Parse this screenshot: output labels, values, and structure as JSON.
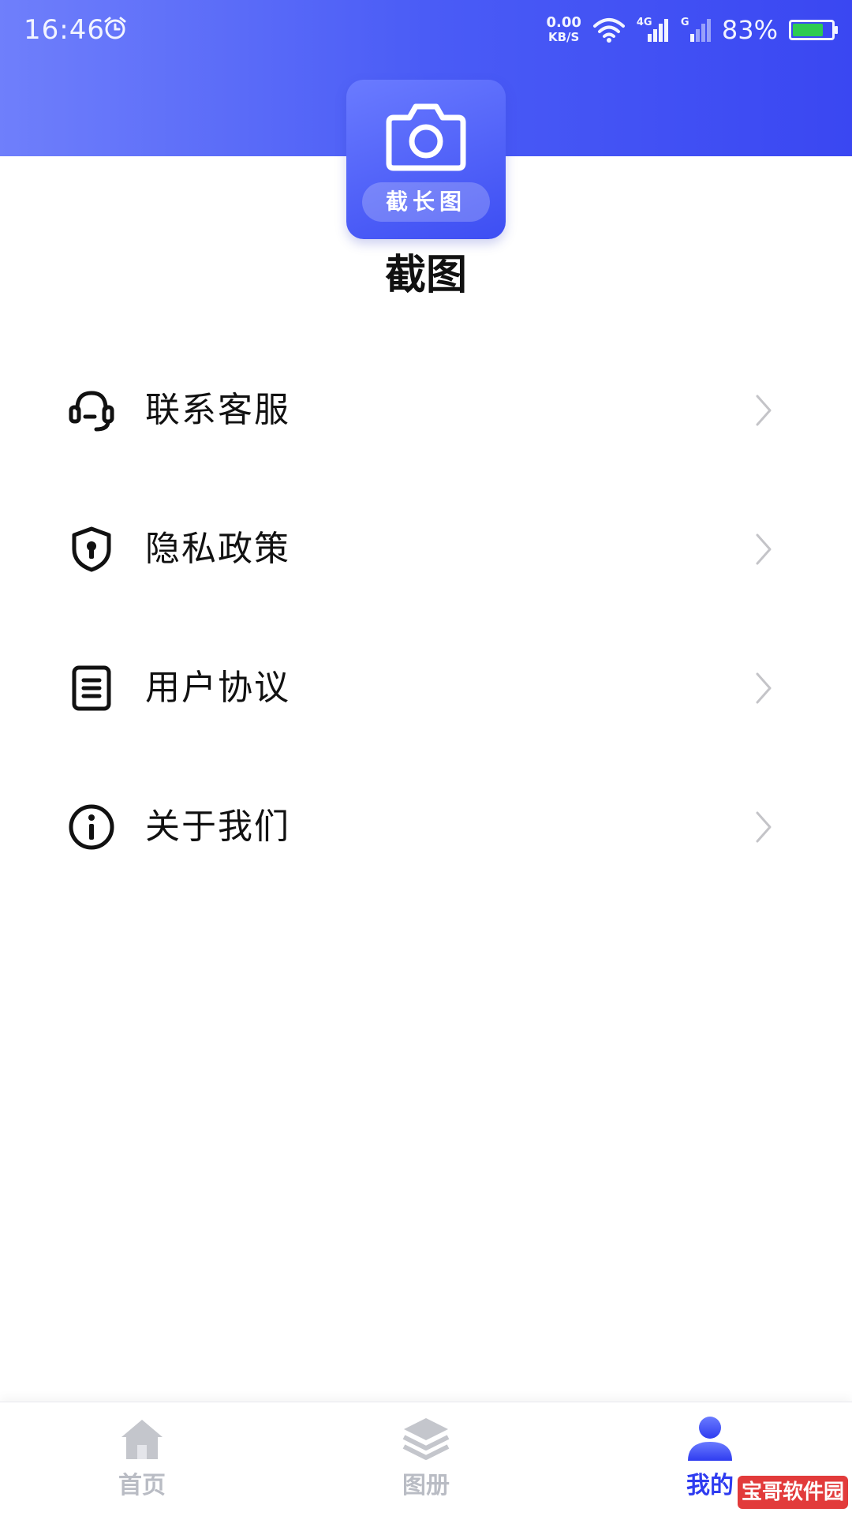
{
  "status_bar": {
    "time": "16:46",
    "net_speed_value": "0.00",
    "net_speed_unit": "KB/S",
    "signal1_label": "4G",
    "signal2_label": "G",
    "battery_percent": "83%",
    "battery_level": 0.83,
    "icons": [
      "alarm-icon",
      "wifi-icon",
      "signal-icon",
      "battery-icon"
    ]
  },
  "app": {
    "icon_badge": "截长图",
    "name": "截图",
    "icon": "camera-icon"
  },
  "menu": {
    "items": [
      {
        "label": "联系客服",
        "icon": "headset-icon"
      },
      {
        "label": "隐私政策",
        "icon": "shield-lock-icon"
      },
      {
        "label": "用户协议",
        "icon": "document-icon"
      },
      {
        "label": "关于我们",
        "icon": "info-icon"
      }
    ]
  },
  "tabbar": {
    "tabs": [
      {
        "label": "首页",
        "icon": "home-icon",
        "active": false
      },
      {
        "label": "图册",
        "icon": "layers-icon",
        "active": false
      },
      {
        "label": "我的",
        "icon": "user-icon",
        "active": true
      }
    ]
  },
  "watermark": "宝哥软件园",
  "colors": {
    "header_start": "#6f7ffb",
    "header_end": "#3a47f2",
    "accent": "#2f3cf0",
    "inactive_tab": "#b9bcc4",
    "text": "#111111",
    "watermark_bg": "#e23b3b"
  }
}
